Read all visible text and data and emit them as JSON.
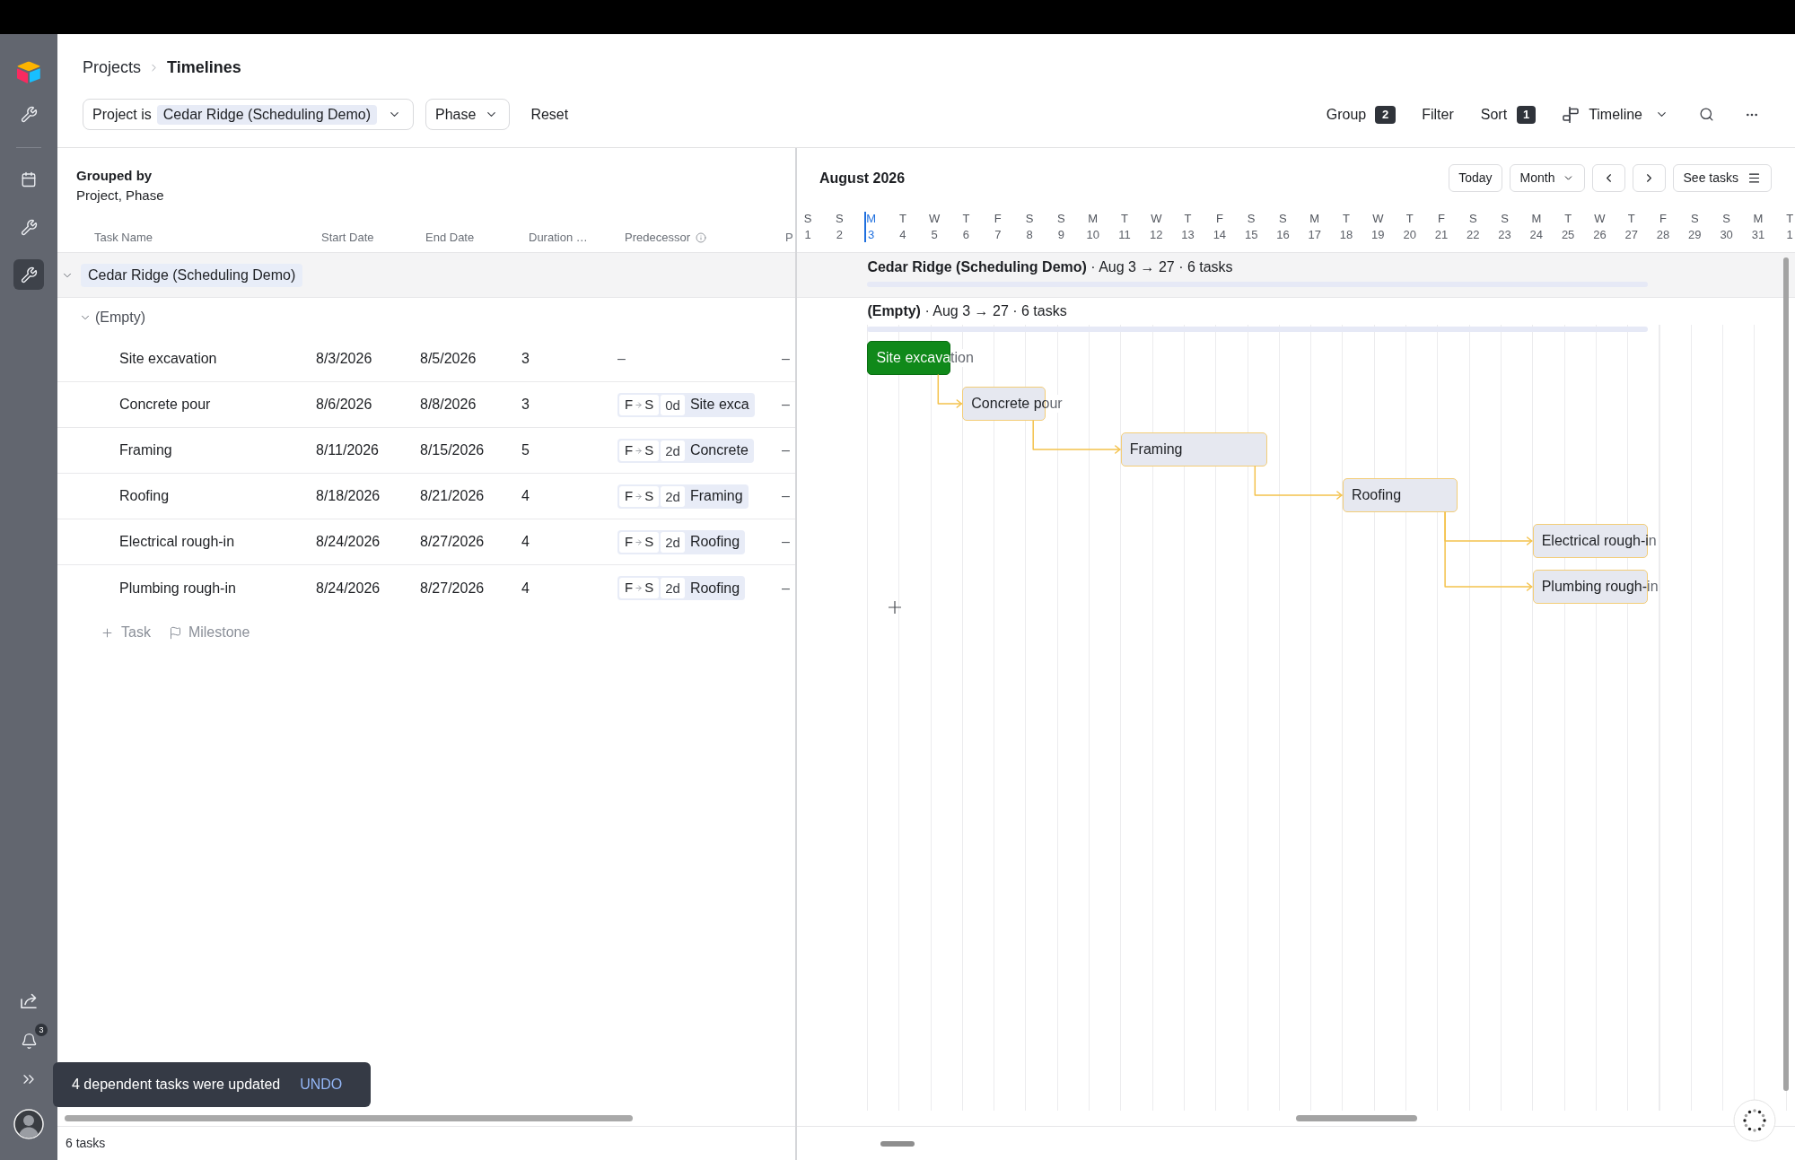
{
  "breadcrumb": [
    {
      "label": "Projects",
      "current": false
    },
    {
      "label": "Timelines",
      "current": true
    }
  ],
  "filters": {
    "project": {
      "label": "Project is",
      "value": "Cedar Ridge (Scheduling Demo)"
    },
    "phase": {
      "label": "Phase"
    },
    "reset": "Reset"
  },
  "toolbar": {
    "group": {
      "label": "Group",
      "count": "2"
    },
    "filter": {
      "label": "Filter"
    },
    "sort": {
      "label": "Sort",
      "count": "1"
    },
    "view": {
      "label": "Timeline"
    }
  },
  "sidebar": {
    "items": [
      {
        "kind": "wrench",
        "selected": false
      },
      {
        "kind": "calendar",
        "selected": false
      },
      {
        "kind": "wrench",
        "selected": false
      },
      {
        "kind": "wrench",
        "selected": true
      }
    ],
    "notification_count": "3"
  },
  "table": {
    "grouped_by": {
      "title": "Grouped by",
      "value": "Project, Phase"
    },
    "columns": [
      "Task Name",
      "Start Date",
      "End Date",
      "Duration …",
      "Predecessor",
      "P"
    ],
    "groups": [
      {
        "label": "Cedar Ridge (Scheduling Demo)",
        "expanded": true,
        "children": [
          {
            "label": "(Empty)",
            "expanded": true,
            "rows": [
              {
                "name": "Site excavation",
                "start": "8/3/2026",
                "end": "8/5/2026",
                "duration": "3",
                "predecessor": {
                  "kind": "none",
                  "text": "–"
                },
                "column_6": "–"
              },
              {
                "name": "Concrete pour",
                "start": "8/6/2026",
                "end": "8/8/2026",
                "duration": "3",
                "predecessor": {
                  "kind": "link",
                  "from": "F",
                  "to": "S",
                  "lag": "0d",
                  "task": "Site exca"
                },
                "column_6": "–"
              },
              {
                "name": "Framing",
                "start": "8/11/2026",
                "end": "8/15/2026",
                "duration": "5",
                "predecessor": {
                  "kind": "link",
                  "from": "F",
                  "to": "S",
                  "lag": "2d",
                  "task": "Concrete"
                },
                "column_6": "–"
              },
              {
                "name": "Roofing",
                "start": "8/18/2026",
                "end": "8/21/2026",
                "duration": "4",
                "predecessor": {
                  "kind": "link",
                  "from": "F",
                  "to": "S",
                  "lag": "2d",
                  "task": "Framing"
                },
                "column_6": "–"
              },
              {
                "name": "Electrical rough-in",
                "start": "8/24/2026",
                "end": "8/27/2026",
                "duration": "4",
                "predecessor": {
                  "kind": "link",
                  "from": "F",
                  "to": "S",
                  "lag": "2d",
                  "task": "Roofing"
                },
                "column_6": "–"
              },
              {
                "name": "Plumbing rough-in",
                "start": "8/24/2026",
                "end": "8/27/2026",
                "duration": "4",
                "predecessor": {
                  "kind": "link",
                  "from": "F",
                  "to": "S",
                  "lag": "2d",
                  "task": "Roofing"
                },
                "column_6": "–"
              }
            ]
          }
        ]
      }
    ],
    "add_task": "Task",
    "add_milestone": "Milestone",
    "footer": "6 tasks"
  },
  "timeline": {
    "month": "August 2026",
    "today_button": "Today",
    "range": "Month",
    "see_tasks": "See tasks",
    "days": [
      {
        "weekday": "S",
        "date": "1",
        "today": false
      },
      {
        "weekday": "S",
        "date": "2",
        "today": false
      },
      {
        "weekday": "M",
        "date": "3",
        "today": true
      },
      {
        "weekday": "T",
        "date": "4",
        "today": false
      },
      {
        "weekday": "W",
        "date": "5",
        "today": false
      },
      {
        "weekday": "T",
        "date": "6",
        "today": false
      },
      {
        "weekday": "F",
        "date": "7",
        "today": false
      },
      {
        "weekday": "S",
        "date": "8",
        "today": false
      },
      {
        "weekday": "S",
        "date": "9",
        "today": false
      },
      {
        "weekday": "M",
        "date": "10",
        "today": false
      },
      {
        "weekday": "T",
        "date": "11",
        "today": false
      },
      {
        "weekday": "W",
        "date": "12",
        "today": false
      },
      {
        "weekday": "T",
        "date": "13",
        "today": false
      },
      {
        "weekday": "F",
        "date": "14",
        "today": false
      },
      {
        "weekday": "S",
        "date": "15",
        "today": false
      },
      {
        "weekday": "S",
        "date": "16",
        "today": false
      },
      {
        "weekday": "M",
        "date": "17",
        "today": false
      },
      {
        "weekday": "T",
        "date": "18",
        "today": false
      },
      {
        "weekday": "W",
        "date": "19",
        "today": false
      },
      {
        "weekday": "T",
        "date": "20",
        "today": false
      },
      {
        "weekday": "F",
        "date": "21",
        "today": false
      },
      {
        "weekday": "S",
        "date": "22",
        "today": false
      },
      {
        "weekday": "S",
        "date": "23",
        "today": false
      },
      {
        "weekday": "M",
        "date": "24",
        "today": false
      },
      {
        "weekday": "T",
        "date": "25",
        "today": false
      },
      {
        "weekday": "W",
        "date": "26",
        "today": false
      },
      {
        "weekday": "T",
        "date": "27",
        "today": false
      },
      {
        "weekday": "F",
        "date": "28",
        "today": false
      },
      {
        "weekday": "S",
        "date": "29",
        "today": false
      },
      {
        "weekday": "S",
        "date": "30",
        "today": false
      },
      {
        "weekday": "M",
        "date": "31",
        "today": false
      },
      {
        "weekday": "T",
        "date": "1",
        "today": false
      }
    ],
    "summaries": [
      {
        "kind": "group",
        "text": "**Cedar Ridge (Scheduling Demo)** · Aug 3 → 27 · 6 tasks"
      },
      {
        "kind": "subgroup",
        "text": "**(Empty)** · Aug 3 → 27 · 6 tasks"
      }
    ],
    "bars": [
      {
        "label": "Site excavation",
        "selected": true,
        "updated": false
      },
      {
        "label": "Concrete pour",
        "selected": false,
        "updated": true
      },
      {
        "label": "Framing",
        "selected": false,
        "updated": true
      },
      {
        "label": "Roofing",
        "selected": false,
        "updated": true
      },
      {
        "label": "Electrical rough-in",
        "selected": false,
        "updated": true
      },
      {
        "label": "Plumbing rough-in",
        "selected": false,
        "updated": true
      }
    ]
  },
  "toast": {
    "message": "4 dependent tasks were updated",
    "action": "UNDO"
  }
}
